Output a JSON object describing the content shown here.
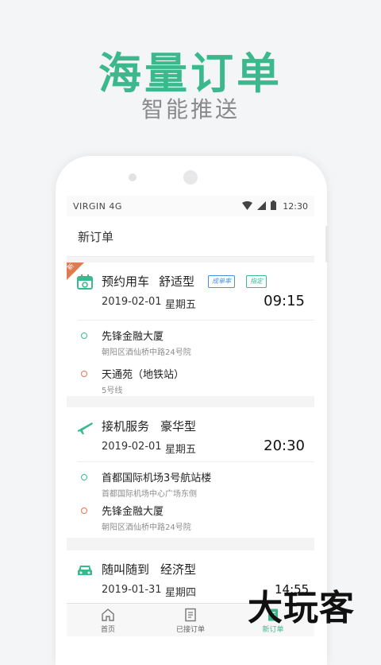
{
  "hero": {
    "title": "海量订单",
    "subtitle": "智能推送"
  },
  "status_bar": {
    "carrier": "VIRGIN 4G",
    "time": "12:30"
  },
  "header": {
    "title": "新订单"
  },
  "orders": [
    {
      "badge": "新",
      "service": "预约用车",
      "car_type": "舒适型",
      "tags": [
        "成单率",
        "指定"
      ],
      "date": "2019-02-01",
      "weekday": "星期五",
      "time": "09:15",
      "icon": "calendar-icon",
      "start": {
        "name": "先锋金融大厦",
        "address": "朝阳区酒仙桥中路24号院"
      },
      "end": {
        "name": "天通苑（地铁站）",
        "address": "5号线"
      }
    },
    {
      "service": "接机服务",
      "car_type": "豪华型",
      "date": "2019-02-01",
      "weekday": "星期五",
      "time": "20:30",
      "icon": "airplane-icon",
      "start": {
        "name": "首都国际机场3号航站楼",
        "address": "首都国际机场中心广场东侧"
      },
      "end": {
        "name": "先锋金融大厦",
        "address": "朝阳区酒仙桥中路24号院"
      }
    },
    {
      "service": "随叫随到",
      "car_type": "经济型",
      "date": "2019-01-31",
      "weekday": "星期四",
      "time": "14:55",
      "icon": "car-icon"
    }
  ],
  "tabs": [
    {
      "label": "首页",
      "icon": "home-icon"
    },
    {
      "label": "已接订单",
      "icon": "document-icon"
    },
    {
      "label": "新订单",
      "icon": "new-order-icon",
      "active": true
    }
  ],
  "watermark": "大玩客",
  "colors": {
    "accent": "#3bb98d",
    "destination": "#e07a4f",
    "tag_blue": "#4a90d9"
  }
}
